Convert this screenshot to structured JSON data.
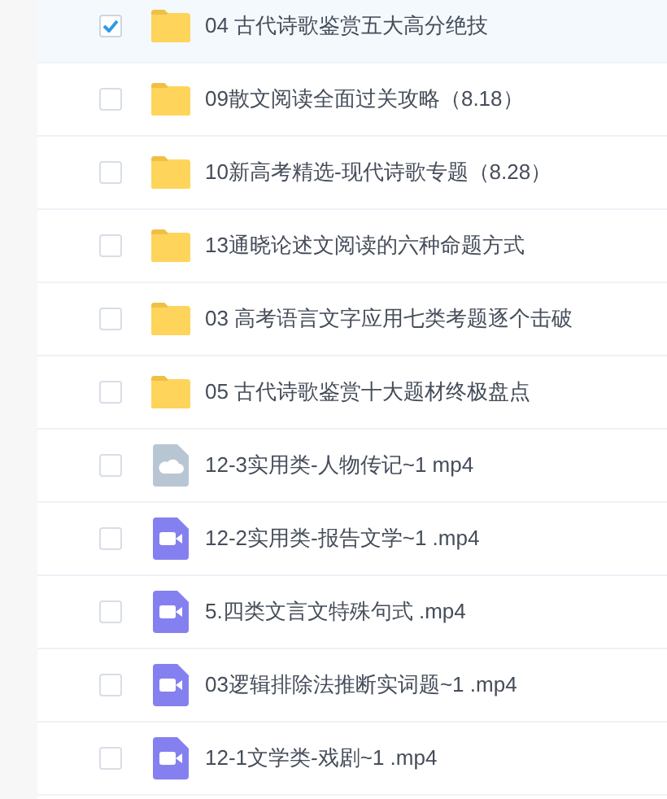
{
  "files": [
    {
      "name": "04 古代诗歌鉴赏五大高分绝技",
      "kind": "folder",
      "selected": true
    },
    {
      "name": "09散文阅读全面过关攻略（8.18）",
      "kind": "folder",
      "selected": false
    },
    {
      "name": "10新高考精选-现代诗歌专题（8.28）",
      "kind": "folder",
      "selected": false
    },
    {
      "name": "13通晓论述文阅读的六种命题方式",
      "kind": "folder",
      "selected": false
    },
    {
      "name": "03 高考语言文字应用七类考题逐个击破",
      "kind": "folder",
      "selected": false
    },
    {
      "name": "05 古代诗歌鉴赏十大题材终极盘点",
      "kind": "folder",
      "selected": false
    },
    {
      "name": "12-3实用类-人物传记~1 mp4",
      "kind": "cloud",
      "selected": false
    },
    {
      "name": "12-2实用类-报告文学~1 .mp4",
      "kind": "video",
      "selected": false
    },
    {
      "name": "5.四类文言文特殊句式 .mp4",
      "kind": "video",
      "selected": false
    },
    {
      "name": "03逻辑排除法推断实词题~1 .mp4",
      "kind": "video",
      "selected": false
    },
    {
      "name": "12-1文学类-戏剧~1 .mp4",
      "kind": "video",
      "selected": false
    }
  ]
}
